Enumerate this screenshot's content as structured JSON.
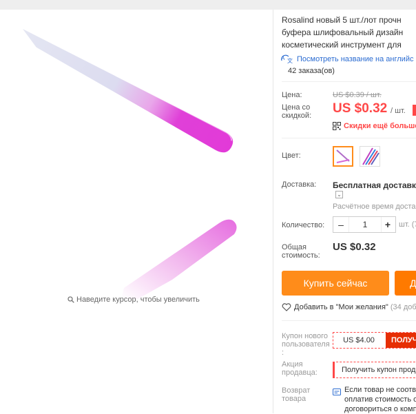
{
  "product": {
    "title_lines": [
      "Rosalind новый 5 шт./лот прочн",
      "буфера шлифовальный дизайн",
      "косметический инструмент для"
    ],
    "translate_link": "Посмотреть название на английс",
    "orders": "42 заказа(ов)"
  },
  "gallery": {
    "zoom_hint": "Наведите курсор, чтобы увеличить",
    "image_name": "pink-glass-nail-file",
    "colors": {
      "file_tip": "#e040d8",
      "file_body": "#dcdcf0"
    }
  },
  "price": {
    "label": "Цена:",
    "original": "US $0.39 / шт.",
    "discount_label_1": "Цена со",
    "discount_label_2": "скидкой:",
    "discount_price": "US $0.32",
    "unit": "/ шт.",
    "extra_discount": "Скидки ещё больше п",
    "accent_color": "#ff4747"
  },
  "color": {
    "label": "Цвет:",
    "options": [
      {
        "name": "single-file",
        "selected": true
      },
      {
        "name": "multi-color-set",
        "selected": false
      }
    ]
  },
  "shipping": {
    "label": "Доставка:",
    "value": "Бесплатная доставка в",
    "eta": "Расчётное время доставк"
  },
  "quantity": {
    "label": "Количество:",
    "minus": "–",
    "value": "1",
    "plus": "+",
    "unit": "шт. (7"
  },
  "total": {
    "label_1": "Общая",
    "label_2": "стоимость:",
    "value": "US $0.32"
  },
  "actions": {
    "buy_now": "Купить сейчас",
    "add_to_cart": "Д",
    "wishlist": "Добавить в \"Мои желания\"",
    "wishlist_count": "(34 доб"
  },
  "coupons": {
    "new_user_label_1": "Купон нового",
    "new_user_label_2": "пользователя",
    "new_user_label_3": ":",
    "new_user_amount": "US $4.00",
    "new_user_get": "ПОЛУЧИ",
    "seller_label_1": "Акция",
    "seller_label_2": "продавца:",
    "seller_action": "Получить купон прод"
  },
  "returns": {
    "label_1": "Возврат",
    "label_2": "товара",
    "text_lines": [
      "Если товар не соотве",
      "оплатив стоимость о",
      "договориться о комп"
    ]
  }
}
